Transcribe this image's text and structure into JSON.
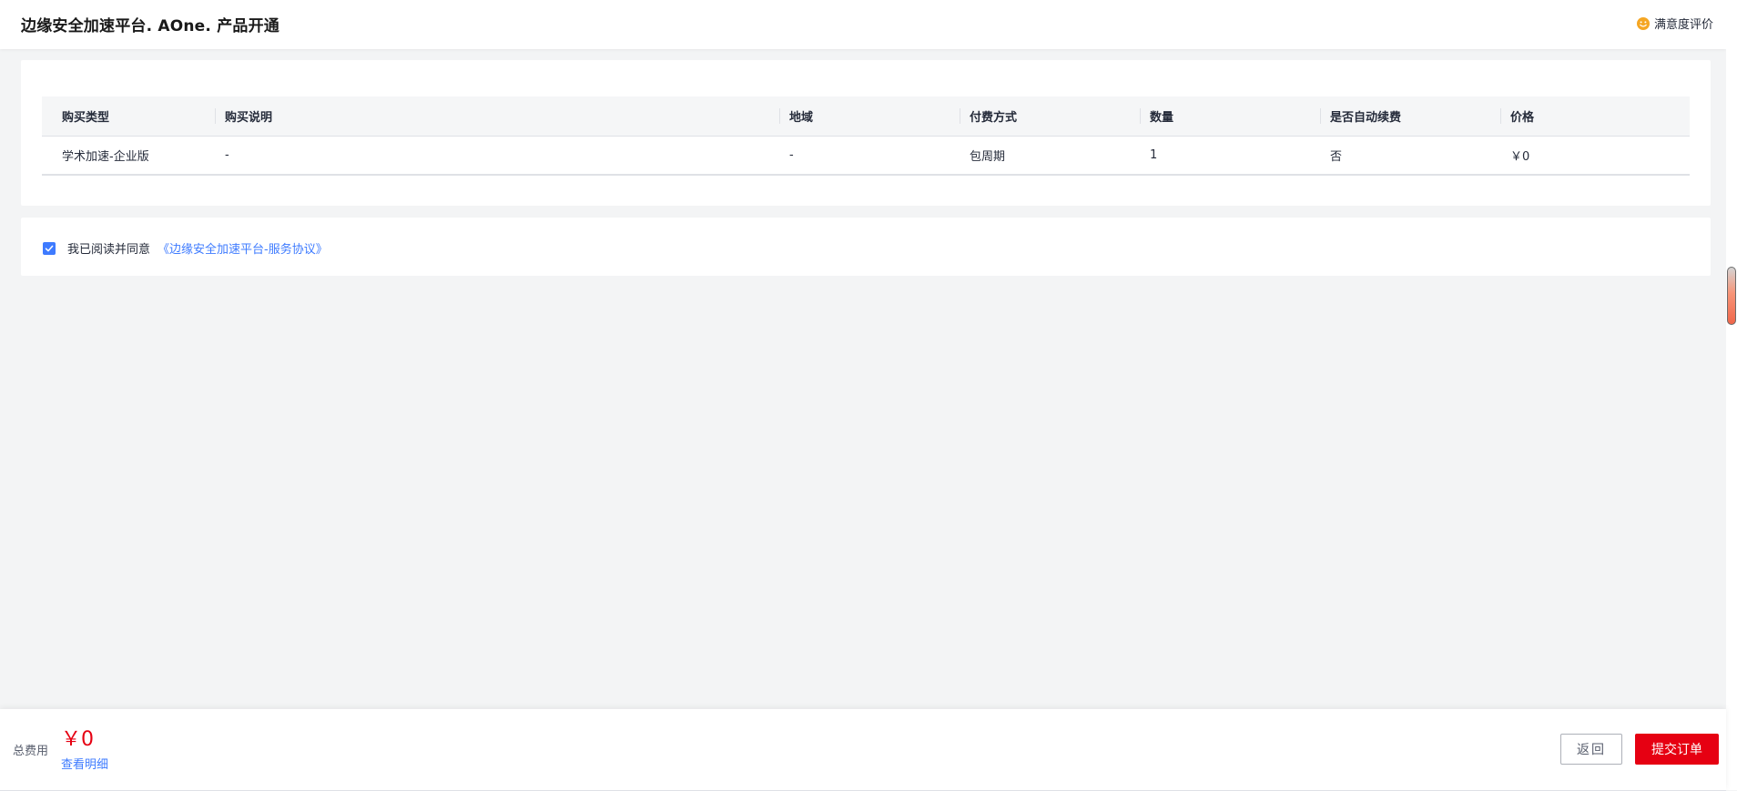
{
  "header": {
    "title": "边缘安全加速平台. AOne. 产品开通",
    "feedback_label": "满意度评价",
    "feedback_icon": "smile-icon"
  },
  "order_table": {
    "columns": [
      "购买类型",
      "购买说明",
      "地域",
      "付费方式",
      "数量",
      "是否自动续费",
      "价格"
    ],
    "rows": [
      {
        "type": "学术加速-企业版",
        "description": "-",
        "region": "-",
        "payment": "包周期",
        "quantity": "1",
        "auto_renew": "否",
        "price": "￥0"
      }
    ]
  },
  "agreement": {
    "checked": true,
    "text": "我已阅读并同意",
    "link": "《边缘安全加速平台-服务协议》"
  },
  "footer": {
    "total_label": "总费用",
    "total_amount": "￥0",
    "detail_link": "查看明细",
    "back_button": "返回",
    "submit_button": "提交订单"
  },
  "colors": {
    "accent": "#3e7bff",
    "price": "#e60012",
    "submit": "#e60012"
  }
}
